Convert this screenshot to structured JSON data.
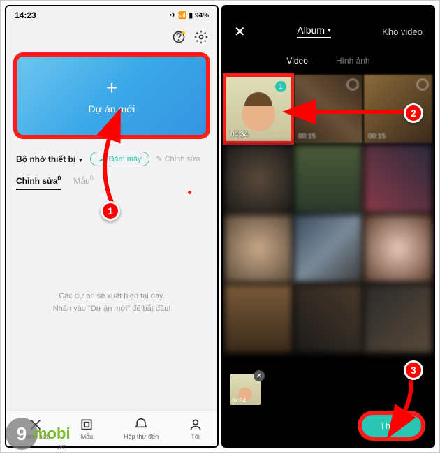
{
  "statusbar": {
    "time": "14:23",
    "battery": "94%"
  },
  "left": {
    "new_project_label": "Dự án mới",
    "storage_label": "Bộ nhớ thiết bị",
    "cloud_label": "Đám mây",
    "edit_label": "Chỉnh sửa",
    "tabs": {
      "edit": "Chỉnh sửa",
      "template": "Mẫu",
      "edit_count": "0",
      "template_count": "0"
    },
    "empty_line1": "Các dự án sẽ xuất hiện tại đây.",
    "empty_line2": "Nhấn vào \"Dự án mới\" để bắt đầu!",
    "nav": {
      "edit": "Chỉnh sửa",
      "template": "Mẫu",
      "inbox": "Hộp thư đến",
      "me": "Tôi"
    }
  },
  "right": {
    "album_label": "Album",
    "stock_label": "Kho video",
    "tab_video": "Video",
    "tab_image": "Hình ảnh",
    "durations": [
      "04:34",
      "00:15",
      "00:15"
    ],
    "selected_num": "1",
    "mini_dur": "04:34",
    "add_label": "Thêm"
  },
  "steps": {
    "s1": "1",
    "s2": "2",
    "s3": "3"
  },
  "watermark": {
    "nine": "9",
    "mobi": "mobi",
    "vn": ".vn"
  }
}
